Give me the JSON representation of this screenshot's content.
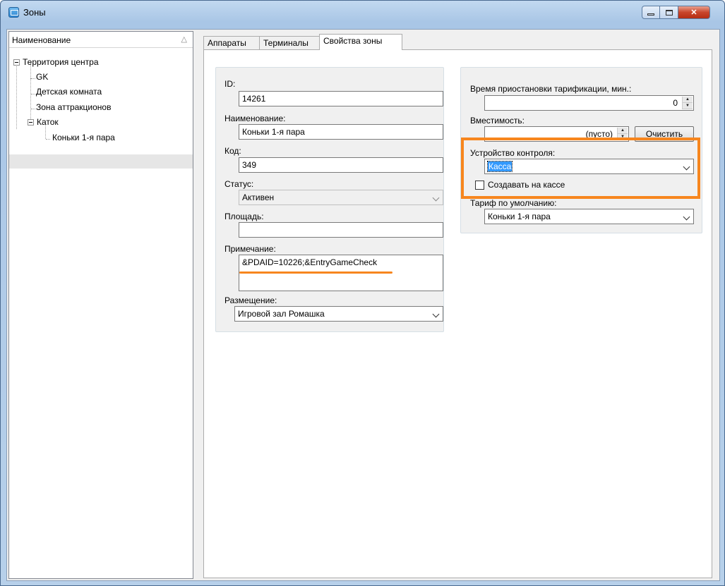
{
  "window": {
    "title": "Зоны",
    "close_glyph": "✕"
  },
  "tree": {
    "header": "Наименование",
    "sort_icon": "△",
    "root": "Территория центра",
    "children": [
      "GK",
      "Детская комната",
      "Зона аттракционов"
    ],
    "katok": "Каток",
    "katok_child": "Коньки 1-я пара"
  },
  "tabs": [
    "Аппараты",
    "Терминалы",
    "Свойства зоны"
  ],
  "form_left": {
    "id_label": "ID:",
    "id_value": "14261",
    "name_label": "Наименование:",
    "name_value": "Коньки 1-я пара",
    "code_label": "Код:",
    "code_value": "349",
    "status_label": "Статус:",
    "status_value": "Активен",
    "area_label": "Площадь:",
    "area_value": "",
    "note_label": "Примечание:",
    "note_value": "&PDAID=10226;&EntryGameCheck",
    "placement_label": "Размещение:",
    "placement_value": "Игровой зал Ромашка"
  },
  "form_right": {
    "pause_label": "Время приостановки тарификации, мин.:",
    "pause_value": "0",
    "capacity_label": "Вместимость:",
    "capacity_value": "(пусто)",
    "clear_button": "Очистить",
    "device_label": "Устройство контроля:",
    "device_value": "Касса",
    "create_checkbox_label": "Создавать на кассе",
    "create_checkbox_checked": false,
    "tariff_label": "Тариф по умолчанию:",
    "tariff_value": "Коньки 1-я пара"
  },
  "colors": {
    "annotation": "#f7861e",
    "selection": "#3399ff"
  }
}
